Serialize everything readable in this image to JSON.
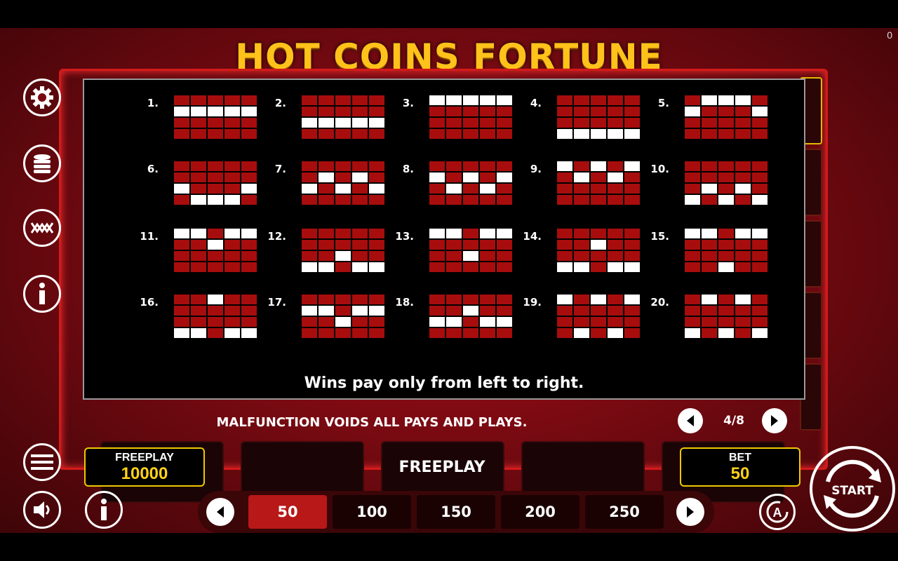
{
  "title": "HOT COINS FORTUNE",
  "corner_value": "0",
  "side_menu": {
    "settings_icon": "gear-icon",
    "coins_icon": "coin-stack-icon",
    "paylines_icon": "paylines-icon",
    "info_icon": "info-icon",
    "menu_icon": "hamburger-icon",
    "sound_icon": "speaker-icon"
  },
  "paytable": {
    "lines": [
      {
        "label": "1.",
        "cells": [
          0,
          0,
          0,
          0,
          0,
          1,
          1,
          1,
          1,
          1,
          0,
          0,
          0,
          0,
          0,
          0,
          0,
          0,
          0,
          0
        ]
      },
      {
        "label": "2.",
        "cells": [
          0,
          0,
          0,
          0,
          0,
          0,
          0,
          0,
          0,
          0,
          1,
          1,
          1,
          1,
          1,
          0,
          0,
          0,
          0,
          0
        ]
      },
      {
        "label": "3.",
        "cells": [
          1,
          1,
          1,
          1,
          1,
          0,
          0,
          0,
          0,
          0,
          0,
          0,
          0,
          0,
          0,
          0,
          0,
          0,
          0,
          0
        ]
      },
      {
        "label": "4.",
        "cells": [
          0,
          0,
          0,
          0,
          0,
          0,
          0,
          0,
          0,
          0,
          0,
          0,
          0,
          0,
          0,
          1,
          1,
          1,
          1,
          1
        ]
      },
      {
        "label": "5.",
        "cells": [
          0,
          1,
          1,
          1,
          0,
          1,
          0,
          0,
          0,
          1,
          0,
          0,
          0,
          0,
          0,
          0,
          0,
          0,
          0,
          0
        ]
      },
      {
        "label": "6.",
        "cells": [
          0,
          0,
          0,
          0,
          0,
          0,
          0,
          0,
          0,
          0,
          1,
          0,
          0,
          0,
          1,
          0,
          1,
          1,
          1,
          0
        ]
      },
      {
        "label": "7.",
        "cells": [
          0,
          0,
          0,
          0,
          0,
          0,
          1,
          0,
          1,
          0,
          1,
          0,
          1,
          0,
          1,
          0,
          0,
          0,
          0,
          0
        ]
      },
      {
        "label": "8.",
        "cells": [
          0,
          0,
          0,
          0,
          0,
          1,
          0,
          1,
          0,
          1,
          0,
          1,
          0,
          1,
          0,
          0,
          0,
          0,
          0,
          0
        ]
      },
      {
        "label": "9.",
        "cells": [
          1,
          0,
          1,
          0,
          1,
          0,
          1,
          0,
          1,
          0,
          0,
          0,
          0,
          0,
          0,
          0,
          0,
          0,
          0,
          0
        ]
      },
      {
        "label": "10.",
        "cells": [
          0,
          0,
          0,
          0,
          0,
          0,
          0,
          0,
          0,
          0,
          0,
          1,
          0,
          1,
          0,
          1,
          0,
          1,
          0,
          1
        ]
      },
      {
        "label": "11.",
        "cells": [
          1,
          1,
          0,
          1,
          1,
          0,
          0,
          1,
          0,
          0,
          0,
          0,
          0,
          0,
          0,
          0,
          0,
          0,
          0,
          0
        ]
      },
      {
        "label": "12.",
        "cells": [
          0,
          0,
          0,
          0,
          0,
          0,
          0,
          0,
          0,
          0,
          0,
          0,
          1,
          0,
          0,
          1,
          1,
          0,
          1,
          1
        ]
      },
      {
        "label": "13.",
        "cells": [
          1,
          1,
          0,
          1,
          1,
          0,
          0,
          0,
          0,
          0,
          0,
          0,
          1,
          0,
          0,
          0,
          0,
          0,
          0,
          0
        ]
      },
      {
        "label": "14.",
        "cells": [
          0,
          0,
          0,
          0,
          0,
          0,
          0,
          1,
          0,
          0,
          0,
          0,
          0,
          0,
          0,
          1,
          1,
          0,
          1,
          1
        ]
      },
      {
        "label": "15.",
        "cells": [
          1,
          1,
          0,
          1,
          1,
          0,
          0,
          0,
          0,
          0,
          0,
          0,
          0,
          0,
          0,
          0,
          0,
          1,
          0,
          0
        ]
      },
      {
        "label": "16.",
        "cells": [
          0,
          0,
          1,
          0,
          0,
          0,
          0,
          0,
          0,
          0,
          0,
          0,
          0,
          0,
          0,
          1,
          1,
          0,
          1,
          1
        ]
      },
      {
        "label": "17.",
        "cells": [
          0,
          0,
          0,
          0,
          0,
          1,
          1,
          0,
          1,
          1,
          0,
          0,
          1,
          0,
          0,
          0,
          0,
          0,
          0,
          0
        ]
      },
      {
        "label": "18.",
        "cells": [
          0,
          0,
          0,
          0,
          0,
          0,
          0,
          1,
          0,
          0,
          1,
          1,
          0,
          1,
          1,
          0,
          0,
          0,
          0,
          0
        ]
      },
      {
        "label": "19.",
        "cells": [
          1,
          0,
          1,
          0,
          1,
          0,
          0,
          0,
          0,
          0,
          0,
          0,
          0,
          0,
          0,
          0,
          1,
          0,
          1,
          0
        ]
      },
      {
        "label": "20.",
        "cells": [
          0,
          1,
          0,
          1,
          0,
          0,
          0,
          0,
          0,
          0,
          0,
          0,
          0,
          0,
          0,
          1,
          0,
          1,
          0,
          1
        ]
      }
    ],
    "wins_note": "Wins pay only from left to right."
  },
  "malfunction_note": "MALFUNCTION VOIDS ALL PAYS AND PLAYS.",
  "pager": {
    "label": "4/8",
    "prev_icon": "chevron-left-icon",
    "next_icon": "chevron-right-icon"
  },
  "freeplay_box": {
    "label": "FREEPLAY",
    "value": "10000"
  },
  "center_status": "FREEPLAY",
  "bet_box": {
    "label": "BET",
    "value": "50"
  },
  "bet_options": [
    "50",
    "100",
    "150",
    "200",
    "250"
  ],
  "selected_bet": "50",
  "start_label": "START",
  "colors": {
    "accent_gold": "#ffc21a",
    "grid_red": "#a80d0d",
    "active_red": "#b81818",
    "box_border": "#f0c800"
  }
}
